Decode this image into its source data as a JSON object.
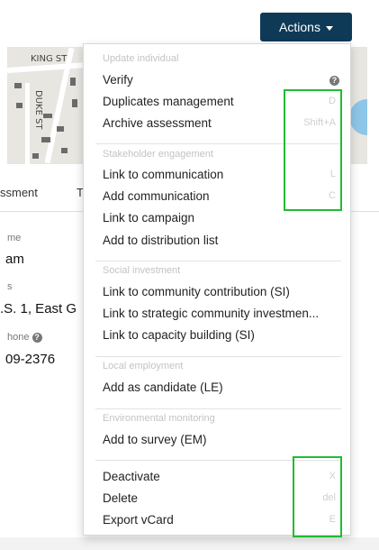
{
  "header": {
    "actions_label": "Actions"
  },
  "map": {
    "street1": "KING ST",
    "street2": "DUKE ST"
  },
  "tabs": [
    "ssment",
    "T"
  ],
  "fields": [
    {
      "label": "me",
      "value": "am"
    },
    {
      "label": "s",
      "value": ".S. 1, East G"
    },
    {
      "label": "hone",
      "value": "09-2376"
    }
  ],
  "menu": {
    "sections": [
      {
        "heading": "Update individual",
        "items": [
          {
            "label": "Verify",
            "shortcut": "",
            "icon": "help-icon"
          },
          {
            "label": "Duplicates management",
            "shortcut": "D"
          },
          {
            "label": "Archive assessment",
            "shortcut": "Shift+A"
          }
        ]
      },
      {
        "heading": "Stakeholder engagement",
        "items": [
          {
            "label": "Link to communication",
            "shortcut": "L"
          },
          {
            "label": "Add communication",
            "shortcut": "C"
          },
          {
            "label": "Link to campaign",
            "shortcut": ""
          },
          {
            "label": "Add to distribution list",
            "shortcut": ""
          }
        ]
      },
      {
        "heading": "Social investment",
        "items": [
          {
            "label": "Link to community contribution (SI)",
            "shortcut": ""
          },
          {
            "label": "Link to strategic community investmen...",
            "shortcut": ""
          },
          {
            "label": "Link to capacity building (SI)",
            "shortcut": ""
          }
        ]
      },
      {
        "heading": "Local employment",
        "items": [
          {
            "label": "Add as candidate (LE)",
            "shortcut": ""
          }
        ]
      },
      {
        "heading": "Environmental monitoring",
        "items": [
          {
            "label": "Add to survey (EM)",
            "shortcut": ""
          }
        ]
      },
      {
        "heading": "",
        "items": [
          {
            "label": "Deactivate",
            "shortcut": "X"
          },
          {
            "label": "Delete",
            "shortcut": "del"
          },
          {
            "label": "Export vCard",
            "shortcut": "E"
          }
        ]
      }
    ]
  },
  "colors": {
    "actions_bg": "#0f3a57",
    "highlight": "#22bb33"
  }
}
